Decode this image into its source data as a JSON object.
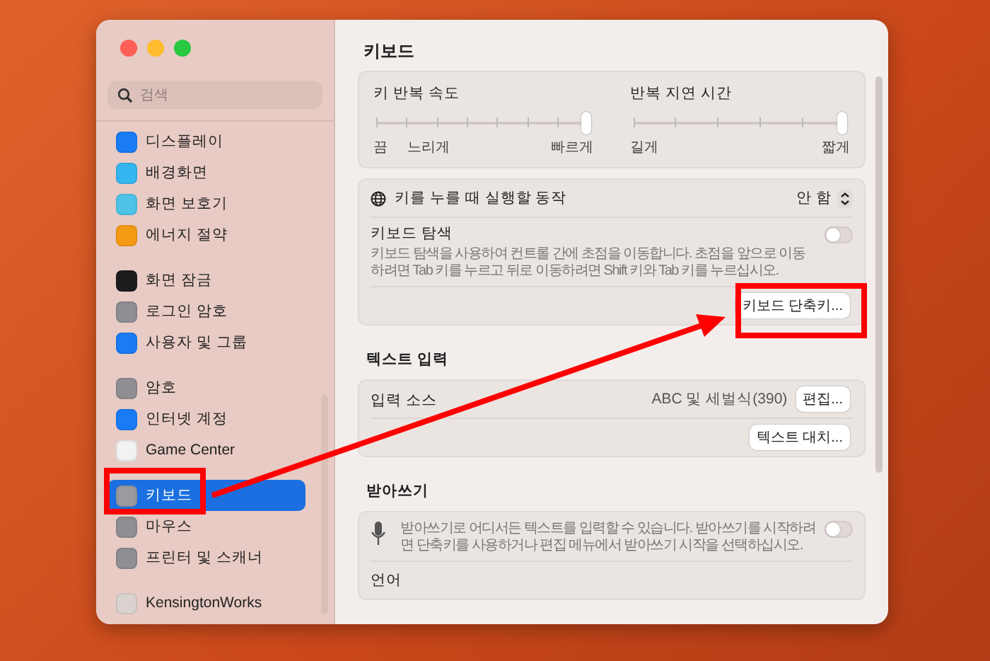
{
  "sidebar": {
    "search": {
      "placeholder": "검색"
    },
    "groups": [
      [
        {
          "label": "디스플레이",
          "color": "#1a7cf5",
          "selected": false
        },
        {
          "label": "배경화면",
          "color": "#35b6f0",
          "selected": false
        },
        {
          "label": "화면 보호기",
          "color": "#4fc3e8",
          "selected": false
        },
        {
          "label": "에너지 절약",
          "color": "#f59a14",
          "selected": false
        }
      ],
      [
        {
          "label": "화면 잠금",
          "color": "#1c1c1e",
          "selected": false
        },
        {
          "label": "로그인 암호",
          "color": "#8e8e93",
          "selected": false
        },
        {
          "label": "사용자 및 그룹",
          "color": "#1a7cf5",
          "selected": false
        }
      ],
      [
        {
          "label": "암호",
          "color": "#8e8e93",
          "selected": false
        },
        {
          "label": "인터넷 계정",
          "color": "#1a7cf5",
          "selected": false
        },
        {
          "label": "Game Center",
          "color": "#f2f2f2",
          "selected": false
        }
      ],
      [
        {
          "label": "키보드",
          "color": "#9a9a9f",
          "selected": true
        },
        {
          "label": "마우스",
          "color": "#8e8e93",
          "selected": false
        },
        {
          "label": "프린터 및 스캐너",
          "color": "#8e8e93",
          "selected": false
        }
      ],
      [
        {
          "label": "KensingtonWorks",
          "color": "#d9d2cf",
          "selected": false
        }
      ]
    ]
  },
  "content": {
    "title": "키보드",
    "sliders": [
      {
        "label": "키 반복 속도",
        "level": 1,
        "scale_labels": [
          "끔",
          "느리게",
          "빠르게"
        ]
      },
      {
        "label": "반복 지연 시간",
        "level": 1,
        "scale_labels": [
          "길게",
          "짧게"
        ]
      }
    ],
    "cards": [
      {
        "rows": [
          {
            "kind": "select",
            "label": "키를 누를 때 실행할 동작",
            "value": "안 함"
          },
          {
            "kind": "toggle",
            "label": "키보드 탐색",
            "description": "키보드 탐색을 사용하여 컨트롤 간에 초점을 이동합니다. 초점을 앞으로 이동하려면 Tab 키를 누르고 뒤로 이동하려면 Shift 키와 Tab 키를 누르십시오.",
            "on": false
          },
          {
            "kind": "button",
            "button": "키보드 단축키..."
          }
        ]
      },
      {
        "heading": "텍스트 입력",
        "rows": [
          {
            "kind": "value-button",
            "label": "입력 소스",
            "value": "ABC 및 세벌식(390)",
            "button": "편집..."
          },
          {
            "kind": "button",
            "button": "텍스트 대치..."
          }
        ]
      },
      {
        "heading": "받아쓰기",
        "rows": [
          {
            "kind": "mic-toggle",
            "description": "받아쓰기로 어디서든 텍스트를 입력할 수 있습니다. 받아쓰기를 시작하려면 단축키를 사용하거나 편집 메뉴에서 받아쓰기 시작을 선택하십시오.",
            "on": false
          },
          {
            "kind": "label",
            "label": "언어"
          }
        ]
      }
    ]
  }
}
